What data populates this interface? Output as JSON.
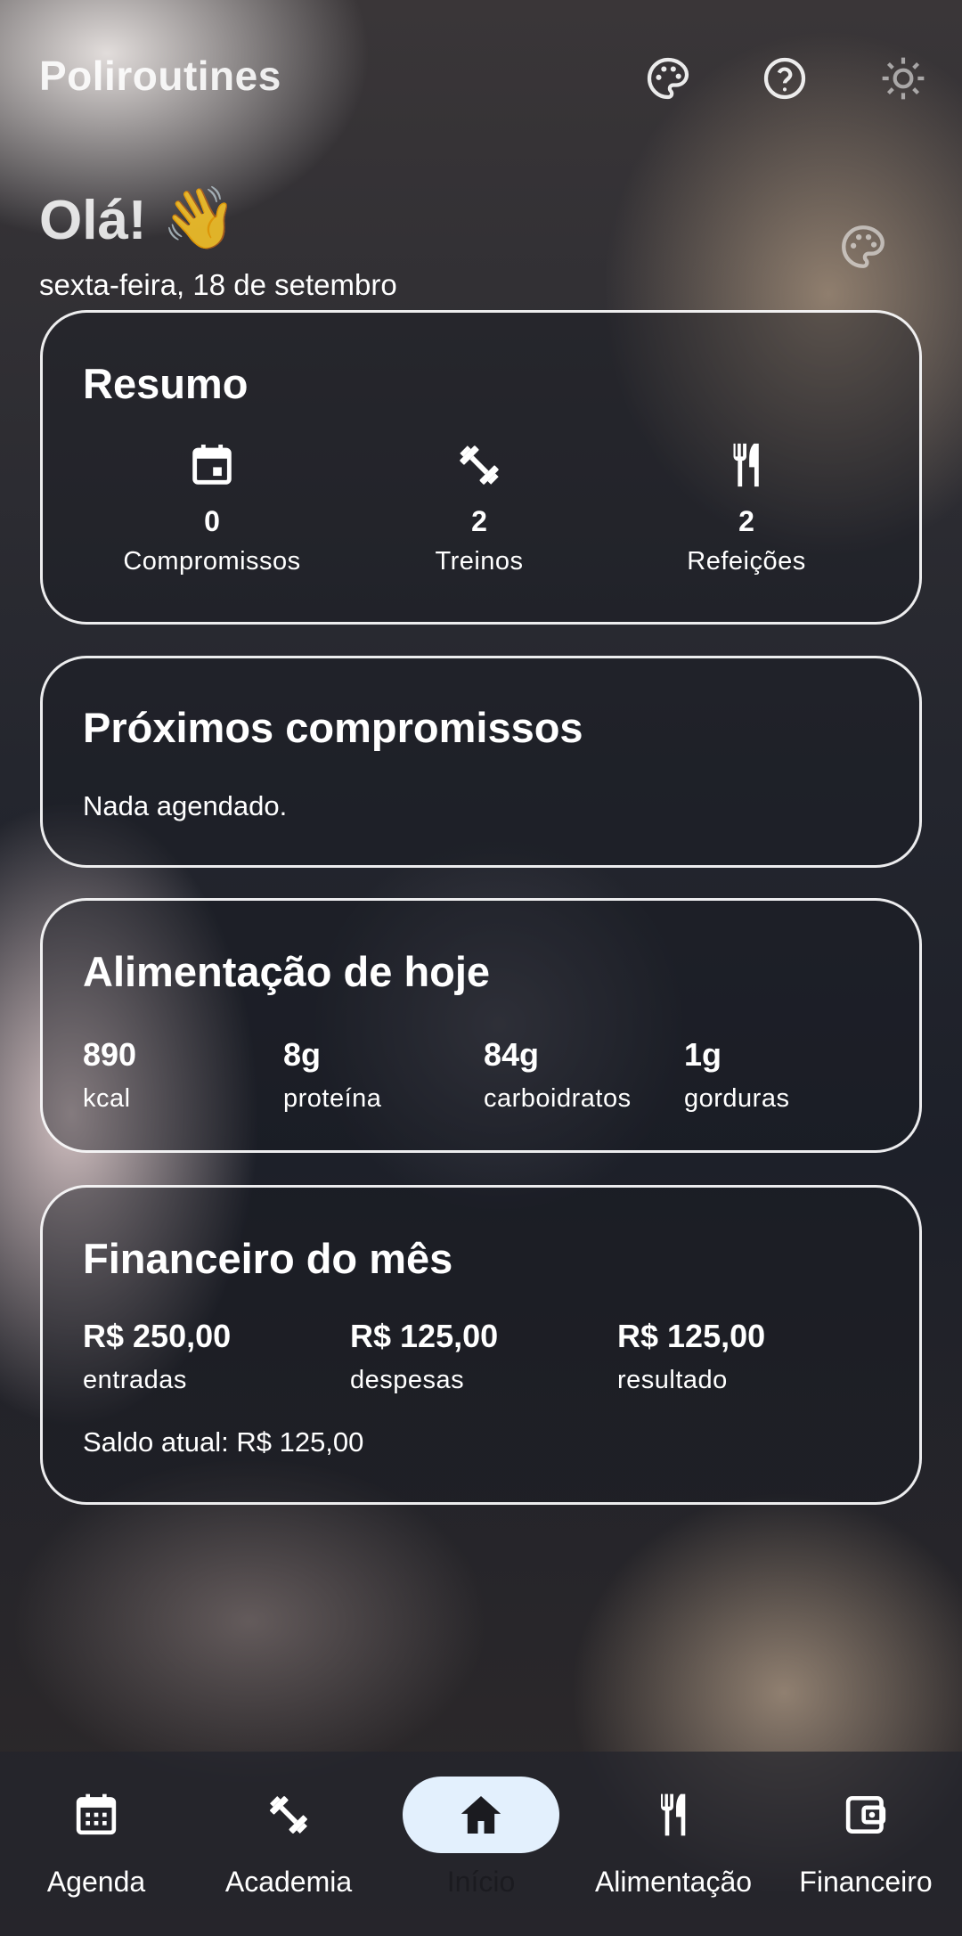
{
  "app_bar": {
    "title": "Poliroutines",
    "actions": [
      {
        "icon": "palette-icon"
      },
      {
        "icon": "help-icon"
      },
      {
        "icon": "brightness-icon"
      }
    ]
  },
  "header": {
    "greeting": "Olá!",
    "wave": "👋",
    "date": "sexta-feira, 18 de setembro"
  },
  "resumo": {
    "title": "Resumo",
    "items": [
      {
        "icon": "calendar-icon",
        "count": "0",
        "label": "Compromissos"
      },
      {
        "icon": "dumbbell-icon",
        "count": "2",
        "label": "Treinos"
      },
      {
        "icon": "restaurant-icon",
        "count": "2",
        "label": "Refeições"
      }
    ]
  },
  "proximos": {
    "title": "Próximos compromissos",
    "empty_text": "Nada agendado."
  },
  "alimentacao": {
    "title": "Alimentação de hoje",
    "stats": [
      {
        "value": "890",
        "label": "kcal"
      },
      {
        "value": "8g",
        "label": "proteína"
      },
      {
        "value": "84g",
        "label": "carboidratos"
      },
      {
        "value": "1g",
        "label": "gorduras"
      }
    ]
  },
  "financeiro": {
    "title": "Financeiro do mês",
    "stats": [
      {
        "value": "R$ 250,00",
        "label": "entradas"
      },
      {
        "value": "R$ 125,00",
        "label": "despesas"
      },
      {
        "value": "R$ 125,00",
        "label": "resultado"
      }
    ],
    "saldo": "Saldo atual: R$ 125,00"
  },
  "nav": {
    "items": [
      {
        "label": "Agenda",
        "icon": "calendar-icon"
      },
      {
        "label": "Academia",
        "icon": "dumbbell-icon"
      },
      {
        "label": "Início",
        "icon": "home-icon",
        "active": true
      },
      {
        "label": "Alimentação",
        "icon": "restaurant-icon"
      },
      {
        "label": "Financeiro",
        "icon": "wallet-icon"
      }
    ]
  },
  "colors": {
    "active_pill": "#e3f0fd",
    "card_border": "#ffffff"
  }
}
